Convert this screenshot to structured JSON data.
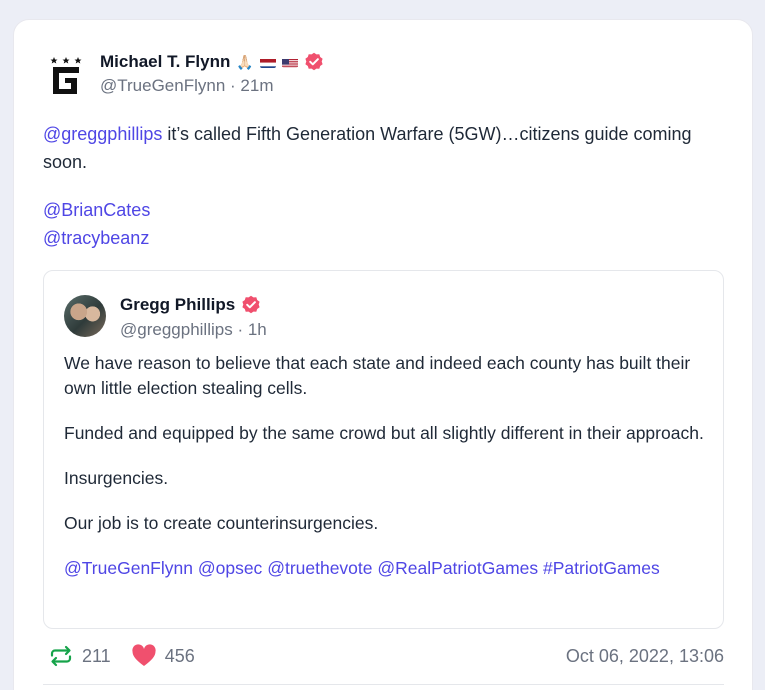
{
  "post": {
    "author_name": "Michael T. Flynn",
    "author_emoji": "🙏🏻",
    "handle": "@TrueGenFlynn",
    "time": "21m",
    "mention_1": "@greggphillips",
    "text_1": " it’s called Fifth Generation Warfare (5GW)…citizens guide coming soon.",
    "mention_2": "@BrianCates",
    "mention_3": "@tracybeanz"
  },
  "quote": {
    "author_name": "Gregg Phillips",
    "handle": "@greggphillips",
    "time": "1h",
    "paragraphs": [
      "We have reason to believe that each state and indeed each county has built their own little election stealing cells.",
      "Funded and equipped by the same crowd but all slightly different in their approach.",
      "Insurgencies.",
      "Our job is to create counterinsurgencies."
    ],
    "tags": [
      "@TrueGenFlynn",
      "@opsec",
      "@truethevote",
      "@RealPatriotGames",
      "#PatriotGames"
    ]
  },
  "footer": {
    "reposts": "211",
    "likes": "456",
    "date": "Oct 06, 2022, 13:06"
  },
  "colors": {
    "accent": "#4f46e5",
    "verified": "#f0506e",
    "repost": "#16a34a",
    "like": "#f0506e"
  }
}
